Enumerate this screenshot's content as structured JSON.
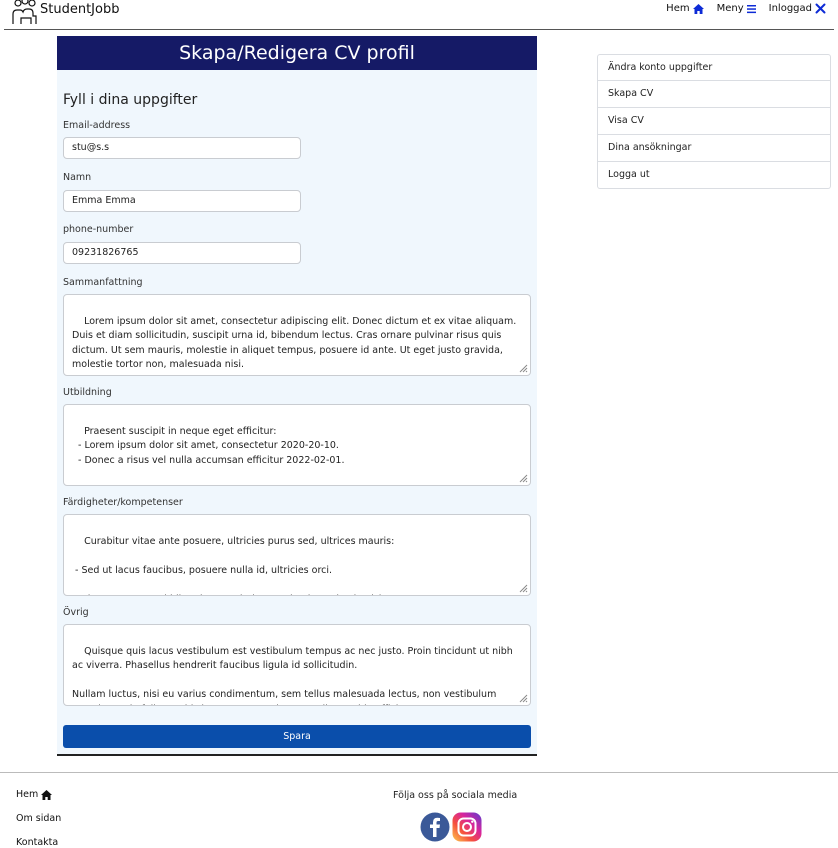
{
  "header": {
    "brand": "StudentJobb",
    "nav": [
      {
        "label": "Hem",
        "icon": "home-icon"
      },
      {
        "label": "Meny",
        "icon": "menu-icon"
      },
      {
        "label": "Inloggad",
        "icon": "tools-icon"
      }
    ]
  },
  "form": {
    "title": "Skapa/Redigera CV profil",
    "heading": "Fyll i dina uppgifter",
    "email": {
      "label": "Email-address",
      "value": "stu@s.s"
    },
    "name": {
      "label": "Namn",
      "value": "Emma Emma"
    },
    "phone": {
      "label": "phone-number",
      "value": "09231826765"
    },
    "summary": {
      "label": "Sammanfattning",
      "value": "Lorem ipsum dolor sit amet, consectetur adipiscing elit. Donec dictum et ex vitae aliquam. Duis et diam sollicitudin, suscipit urna id, bibendum lectus. Cras ornare pulvinar risus quis dictum. Ut sem mauris, molestie in aliquet tempus, posuere id ante. Ut eget justo gravida, molestie tortor non, malesuada nisi."
    },
    "education": {
      "label": "Utbildning",
      "value": "Praesent suscipit in neque eget efficitur:\n  - Lorem ipsum dolor sit amet, consectetur 2020-20-10.\n  - Donec a risus vel nulla accumsan efficitur 2022-02-01."
    },
    "skills": {
      "label": "Färdigheter/kompetenser",
      "value": "Curabitur vitae ante posuere, ultricies purus sed, ultrices mauris:\n\n - Sed ut lacus faucibus, posuere nulla id, ultricies orci.\n\n - Vivamus eget orci bibendum, scelerisque mi quis, molestie nisl."
    },
    "other": {
      "label": "Övrig",
      "value": "Quisque quis lacus vestibulum est vestibulum tempus ac nec justo. Proin tincidunt ut nibh ac viverra. Phasellus hendrerit faucibus ligula id sollicitudin.\n\nNullam luctus, nisi eu varius condimentum, sem tellus malesuada lectus, non vestibulum nunc lectus in felis. Morbi sit amet metus sit amet odio gravida efficitur."
    },
    "save_label": "Spara"
  },
  "sidebar": {
    "items": [
      {
        "label": "Ändra konto uppgifter"
      },
      {
        "label": "Skapa CV"
      },
      {
        "label": "Visa CV"
      },
      {
        "label": "Dina ansökningar"
      },
      {
        "label": "Logga ut"
      }
    ]
  },
  "footer": {
    "links": [
      {
        "label": "Hem",
        "icon": "home-icon"
      },
      {
        "label": "Om sidan"
      },
      {
        "label": "Kontakta"
      }
    ],
    "follow_text": "Följa oss på sociala media",
    "social": [
      {
        "icon": "facebook-icon",
        "color": "#3b5998"
      },
      {
        "icon": "instagram-icon",
        "color": "#d6249f"
      }
    ]
  },
  "colors": {
    "title_bar": "#151a66",
    "panel_bg": "#f0f7fd",
    "save_button": "#0a4eab",
    "nav_icon": "#0d2bd6"
  }
}
